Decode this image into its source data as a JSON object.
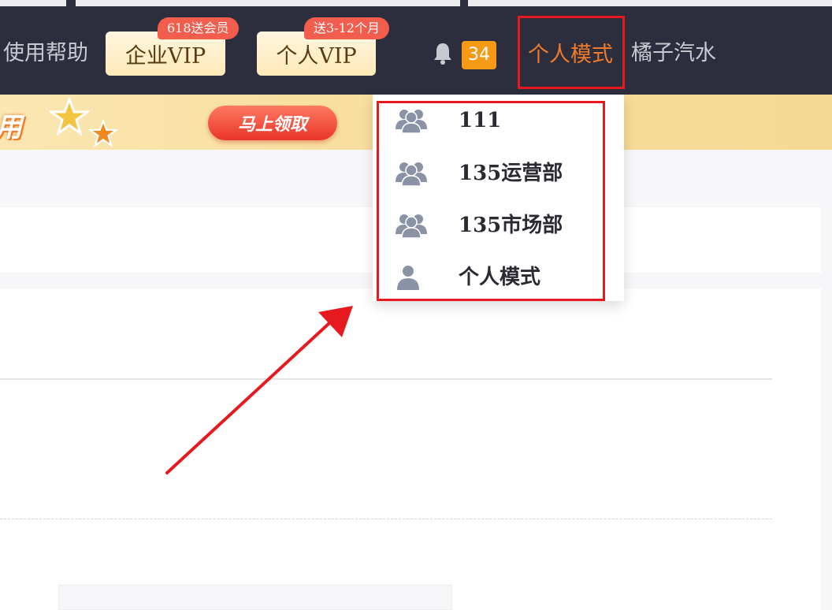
{
  "header": {
    "help_label": "使用帮助",
    "enterprise_vip": {
      "label": "企业VIP",
      "badge": "618送会员"
    },
    "personal_vip": {
      "label": "个人VIP",
      "badge": "送3-12个月"
    },
    "notification_count": "34",
    "mode_label": "个人模式",
    "username": "橘子汽水"
  },
  "promo": {
    "text_fragment": "用",
    "claim_button": "马上领取"
  },
  "mode_dropdown": {
    "items": [
      {
        "label": "111",
        "icon": "group-icon"
      },
      {
        "label": "135运营部",
        "icon": "group-icon"
      },
      {
        "label": "135市场部",
        "icon": "group-icon"
      },
      {
        "label": "个人模式",
        "icon": "user-icon"
      }
    ]
  },
  "colors": {
    "nav_bg": "#2c2e3e",
    "accent_orange": "#f07a2a",
    "annotation_red": "#e6191f",
    "badge_red": "#f25d4d",
    "count_badge": "#f59a14"
  }
}
